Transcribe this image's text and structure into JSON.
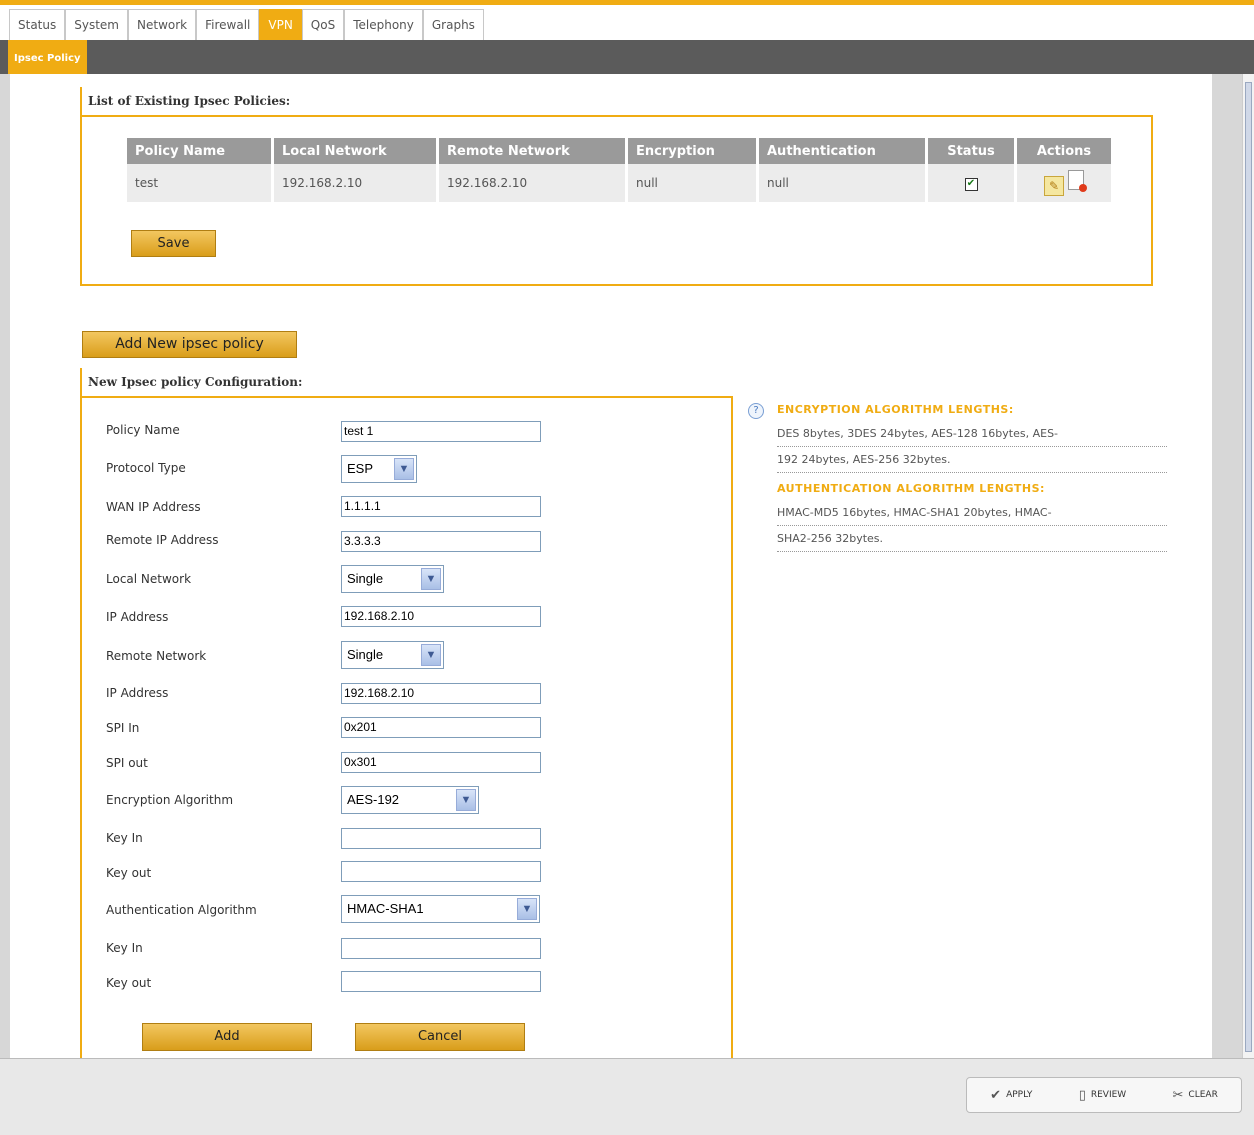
{
  "tabs": [
    {
      "label": "Status"
    },
    {
      "label": "System"
    },
    {
      "label": "Network"
    },
    {
      "label": "Firewall"
    },
    {
      "label": "VPN",
      "active": true
    },
    {
      "label": "QoS"
    },
    {
      "label": "Telephony"
    },
    {
      "label": "Graphs"
    }
  ],
  "subtab": "Ipsec Policy",
  "existing": {
    "legend": "List of Existing Ipsec Policies:",
    "headers": [
      "Policy Name",
      "Local Network",
      "Remote Network",
      "Encryption",
      "Authentication",
      "Status",
      "Actions"
    ],
    "rows": [
      {
        "policy_name": "test",
        "local_network": "192.168.2.10",
        "remote_network": "192.168.2.10",
        "encryption": "null",
        "authentication": "null",
        "status_checked": true
      }
    ],
    "save_label": "Save"
  },
  "add_new_label": "Add New ipsec policy",
  "config": {
    "legend": "New Ipsec policy Configuration:",
    "fields": {
      "policy_name": {
        "label": "Policy Name",
        "value": "test 1"
      },
      "protocol_type": {
        "label": "Protocol Type",
        "value": "ESP"
      },
      "wan_ip": {
        "label": "WAN IP Address",
        "value": "1.1.1.1"
      },
      "remote_ip": {
        "label": "Remote IP Address",
        "value": "3.3.3.3"
      },
      "local_network": {
        "label": "Local Network",
        "value": "Single"
      },
      "local_ip": {
        "label": "IP Address",
        "value": "192.168.2.10"
      },
      "remote_network": {
        "label": "Remote Network",
        "value": "Single"
      },
      "remote_net_ip": {
        "label": "IP Address",
        "value": "192.168.2.10"
      },
      "spi_in": {
        "label": "SPI In",
        "value": "0x201"
      },
      "spi_out": {
        "label": "SPI out",
        "value": "0x301"
      },
      "enc_algo": {
        "label": "Encryption Algorithm",
        "value": "AES-192"
      },
      "enc_key_in": {
        "label": "Key In",
        "value": ""
      },
      "enc_key_out": {
        "label": "Key out",
        "value": ""
      },
      "auth_algo": {
        "label": "Authentication Algorithm",
        "value": "HMAC-SHA1"
      },
      "auth_key_in": {
        "label": "Key In",
        "value": ""
      },
      "auth_key_out": {
        "label": "Key out",
        "value": ""
      }
    },
    "add_label": "Add",
    "cancel_label": "Cancel"
  },
  "help": {
    "enc_title": "ENCRYPTION ALGORITHM LENGTHS:",
    "enc_line1": "DES 8bytes, 3DES 24bytes, AES-128 16bytes, AES-",
    "enc_line2": "192 24bytes, AES-256 32bytes.",
    "auth_title": "AUTHENTICATION ALGORITHM LENGTHS:",
    "auth_line1": "HMAC-MD5 16bytes, HMAC-SHA1 20bytes, HMAC-",
    "auth_line2": "SHA2-256 32bytes."
  },
  "footer": {
    "apply": "APPLY",
    "review": "REVIEW",
    "clear": "CLEAR"
  },
  "colors": {
    "accent": "#f0ac13",
    "header_gray": "#9a9a9a",
    "bar_dark": "#5b5b5b"
  }
}
